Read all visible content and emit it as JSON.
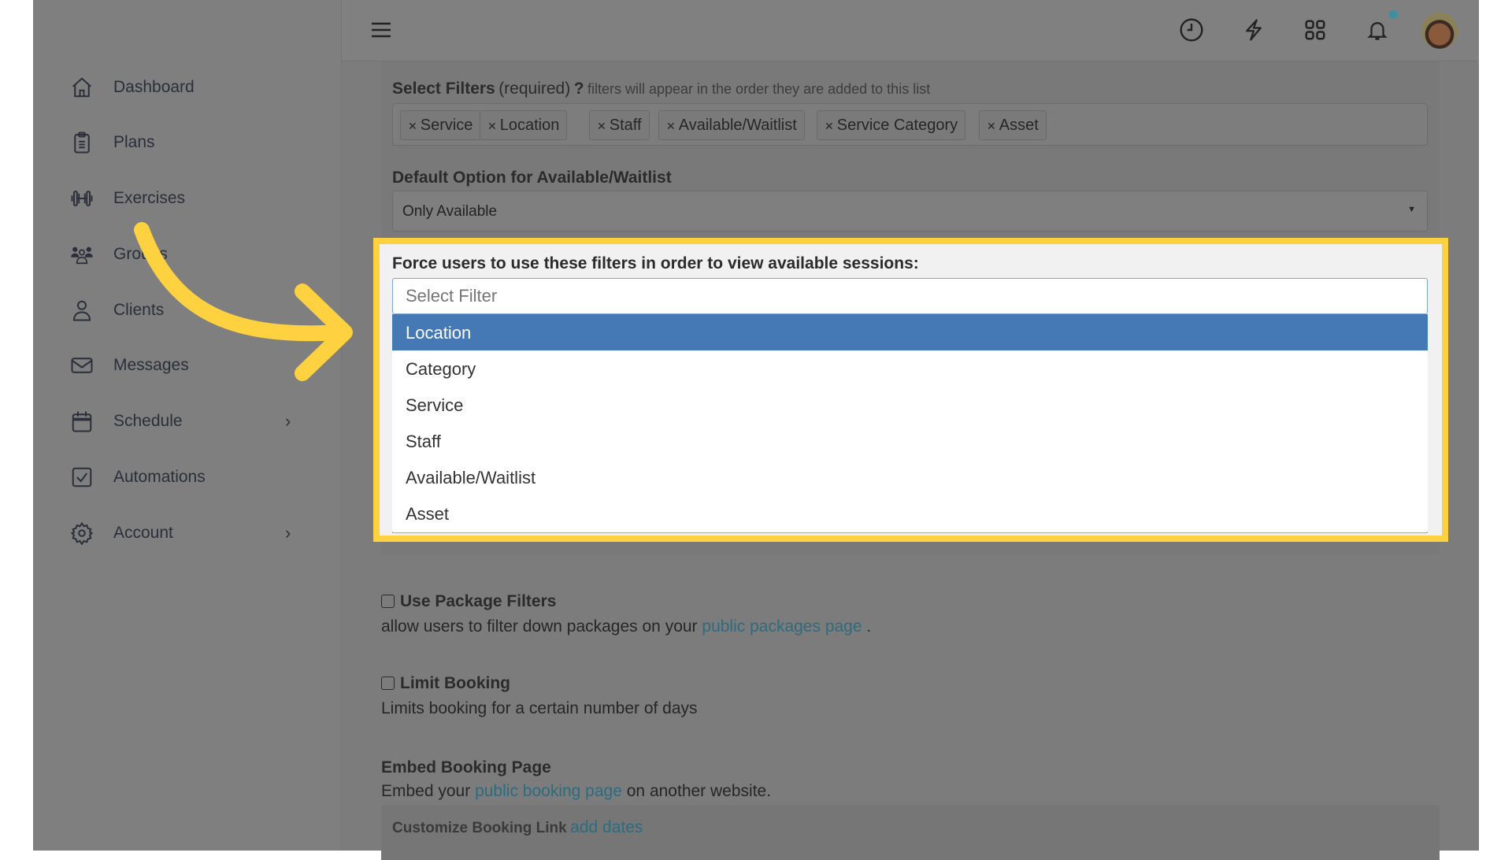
{
  "sidebar": {
    "items": [
      {
        "label": "Dashboard",
        "icon": "home-icon"
      },
      {
        "label": "Plans",
        "icon": "clipboard-icon"
      },
      {
        "label": "Exercises",
        "icon": "dumbbell-icon"
      },
      {
        "label": "Groups",
        "icon": "group-icon"
      },
      {
        "label": "Clients",
        "icon": "user-icon"
      },
      {
        "label": "Messages",
        "icon": "mail-icon"
      },
      {
        "label": "Schedule",
        "icon": "calendar-icon"
      },
      {
        "label": "Automations",
        "icon": "checkbox-icon"
      },
      {
        "label": "Account",
        "icon": "gear-icon"
      }
    ]
  },
  "header": {
    "icons": [
      "menu-icon",
      "clock-icon",
      "bolt-icon",
      "grid-icon",
      "bell-icon",
      "avatar"
    ],
    "notification_dot_color": "#3f8fa3"
  },
  "filters": {
    "title": "Select Filters",
    "required": "(required)",
    "help": "?",
    "hint": "filters will appear in the order they are added to this list",
    "tags": [
      "Service",
      "Location",
      "Staff",
      "Available/Waitlist",
      "Service Category",
      "Asset"
    ]
  },
  "default_option": {
    "label": "Default Option for Available/Waitlist",
    "value": "Only Available"
  },
  "force": {
    "label": "Force users to use these filters in order to view available sessions:",
    "placeholder": "Select Filter",
    "options": [
      "Location",
      "Category",
      "Service",
      "Staff",
      "Available/Waitlist",
      "Asset"
    ],
    "highlighted": "Location"
  },
  "package": {
    "label": "Use Package Filters",
    "text": "allow users to filter down packages on your",
    "link": "public packages page",
    "end": "."
  },
  "limit": {
    "label": "Limit Booking",
    "text": "Limits booking for a certain number of days"
  },
  "embed": {
    "title": "Embed Booking Page",
    "text_pre": "Embed your",
    "link": "public booking page",
    "text_post": "on another website."
  },
  "customize": {
    "label": "Customize Booking Link",
    "link": "add dates"
  },
  "colors": {
    "highlight_border": "#fdd13f",
    "selected_option": "#4479b5",
    "link": "#2d6b7e",
    "arrow": "#fdd13f"
  }
}
